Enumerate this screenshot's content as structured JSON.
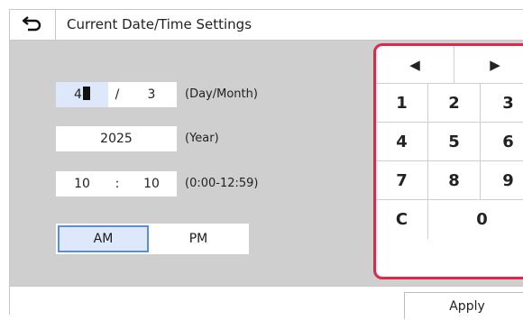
{
  "header": {
    "title": "Current Date/Time Settings",
    "back_icon": "back-arrow-icon"
  },
  "date": {
    "day": "4",
    "separator": "/",
    "month": "3",
    "label": "(Day/Month)"
  },
  "year": {
    "value": "2025",
    "label": "(Year)"
  },
  "time": {
    "hour": "10",
    "separator": ":",
    "minute": "10",
    "label": "(0:00-12:59)"
  },
  "ampm": {
    "am": "AM",
    "pm": "PM",
    "selected": "AM"
  },
  "keypad": {
    "left_arrow": "◀",
    "right_arrow": "▶",
    "keys": [
      "1",
      "2",
      "3",
      "4",
      "5",
      "6",
      "7",
      "8",
      "9"
    ],
    "clear": "C",
    "zero": "0"
  },
  "footer": {
    "apply_label": "Apply"
  },
  "colors": {
    "accent_border": "#e0264a",
    "selected_fill": "#dde9fb",
    "selected_border": "#5a8fd6",
    "panel": "#cfcfcf"
  }
}
